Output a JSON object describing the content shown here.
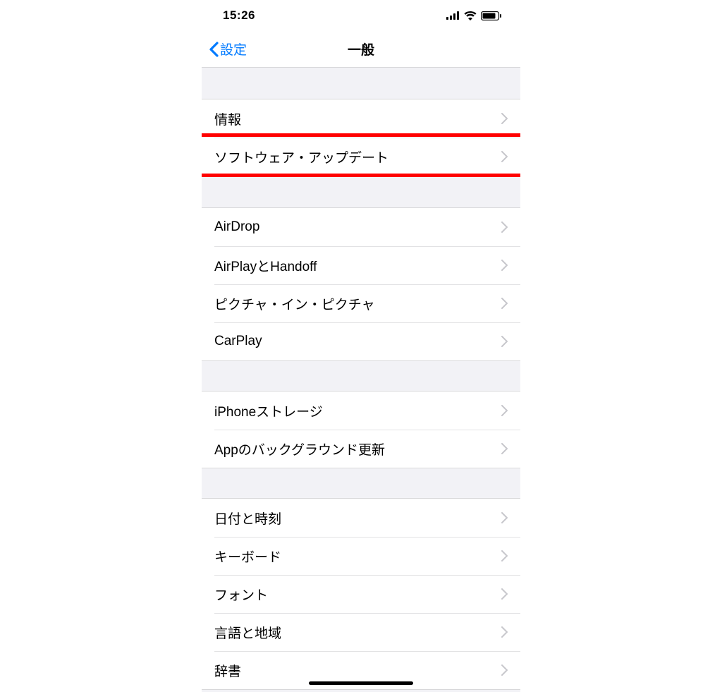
{
  "status": {
    "time": "15:26"
  },
  "nav": {
    "back_label": "設定",
    "title": "一般"
  },
  "sections": [
    {
      "rows": [
        {
          "label": "情報",
          "highlighted": false
        },
        {
          "label": "ソフトウェア・アップデート",
          "highlighted": true
        }
      ]
    },
    {
      "rows": [
        {
          "label": "AirDrop",
          "highlighted": false
        },
        {
          "label": "AirPlayとHandoff",
          "highlighted": false
        },
        {
          "label": "ピクチャ・イン・ピクチャ",
          "highlighted": false
        },
        {
          "label": "CarPlay",
          "highlighted": false
        }
      ]
    },
    {
      "rows": [
        {
          "label": "iPhoneストレージ",
          "highlighted": false
        },
        {
          "label": "Appのバックグラウンド更新",
          "highlighted": false
        }
      ]
    },
    {
      "rows": [
        {
          "label": "日付と時刻",
          "highlighted": false
        },
        {
          "label": "キーボード",
          "highlighted": false
        },
        {
          "label": "フォント",
          "highlighted": false
        },
        {
          "label": "言語と地域",
          "highlighted": false
        },
        {
          "label": "辞書",
          "highlighted": false
        }
      ]
    }
  ]
}
